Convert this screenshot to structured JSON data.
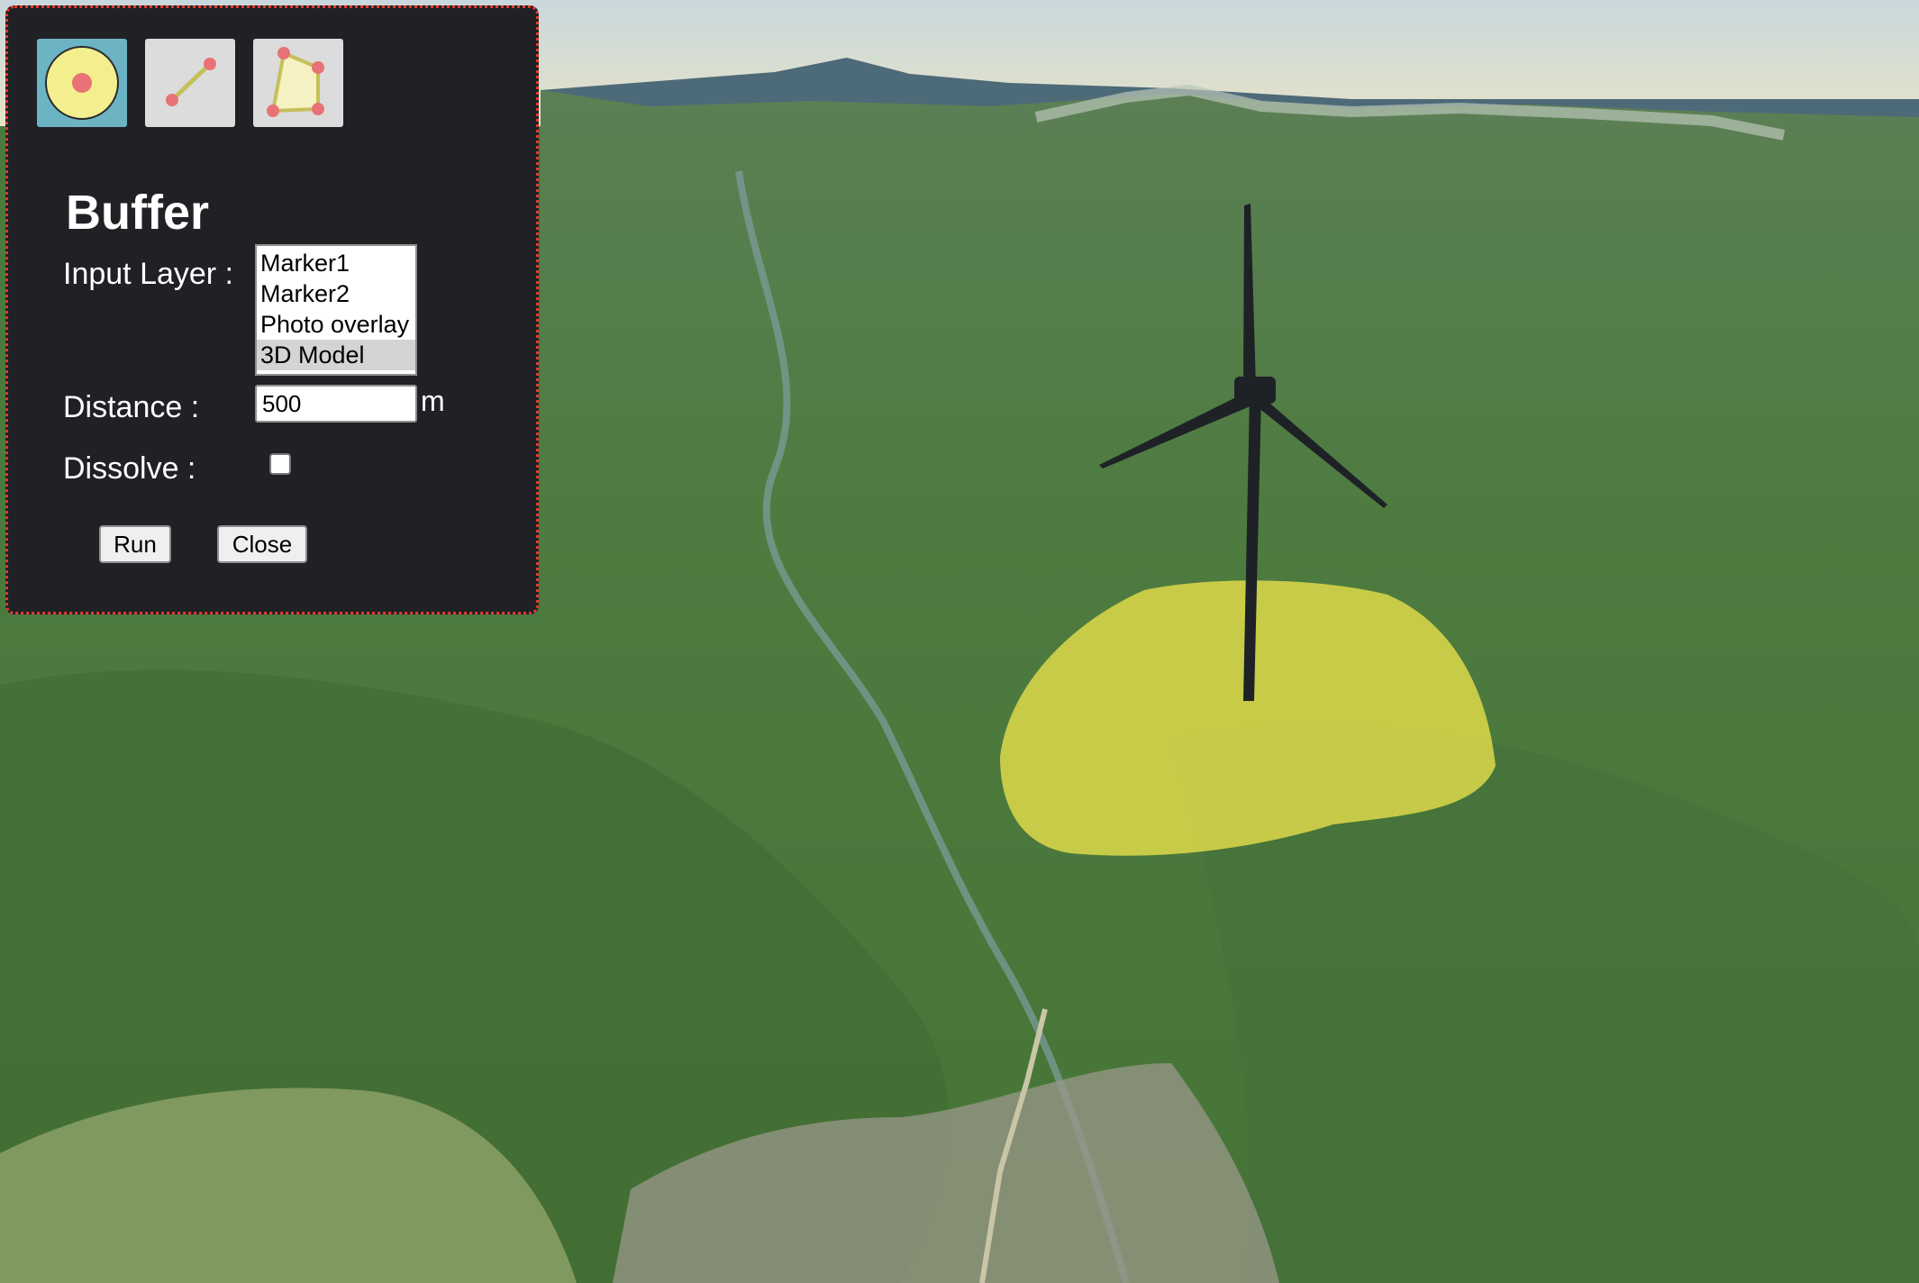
{
  "toolbar": {
    "tools": [
      {
        "name": "buffer-tool",
        "icon": "circle-buffer-icon",
        "active": true
      },
      {
        "name": "line-tool",
        "icon": "line-icon",
        "active": false
      },
      {
        "name": "polygon-tool",
        "icon": "polygon-icon",
        "active": false
      }
    ]
  },
  "panel": {
    "title": "Buffer",
    "input_layer_label": "Input Layer :",
    "layers": [
      "Marker1",
      "Marker2",
      "Photo overlay",
      "3D Model"
    ],
    "selected_layer": "3D Model",
    "distance_label": "Distance :",
    "distance_value": "500",
    "distance_unit": "m",
    "dissolve_label": "Dissolve :",
    "dissolve_checked": false,
    "run_label": "Run",
    "close_label": "Close"
  },
  "colors": {
    "panel_bg": "#202125",
    "panel_border": "#e33b2c",
    "buffer_fill": "#d8d64a",
    "turbine": "#1e2226",
    "active_tool": "#6cb4c4"
  }
}
